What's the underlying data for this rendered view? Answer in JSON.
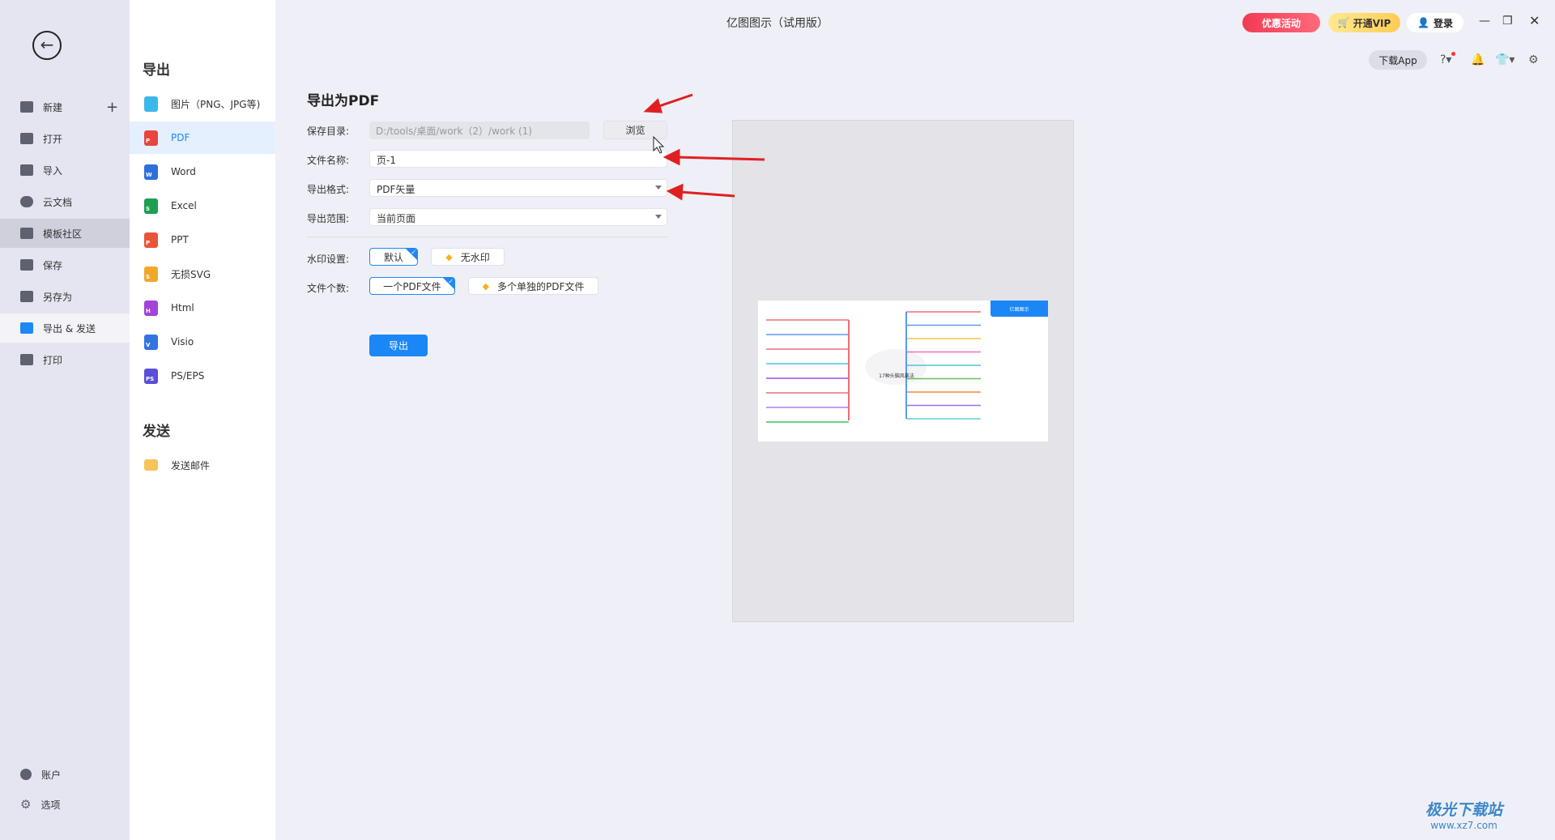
{
  "window": {
    "title": "亿图图示（试用版）"
  },
  "topbar": {
    "promo": "优惠活动",
    "vip": "开通VIP",
    "login": "登录",
    "download_app": "下载App"
  },
  "sidebar": {
    "items": [
      {
        "label": "新建",
        "icon": "plus-square-icon"
      },
      {
        "label": "打开",
        "icon": "folder-icon"
      },
      {
        "label": "导入",
        "icon": "import-icon"
      },
      {
        "label": "云文档",
        "icon": "cloud-icon"
      },
      {
        "label": "模板社区",
        "icon": "community-icon"
      },
      {
        "label": "保存",
        "icon": "save-icon"
      },
      {
        "label": "另存为",
        "icon": "save-as-icon"
      },
      {
        "label": "导出 & 发送",
        "icon": "export-icon"
      },
      {
        "label": "打印",
        "icon": "print-icon"
      }
    ],
    "bottom": [
      {
        "label": "账户",
        "icon": "account-icon"
      },
      {
        "label": "选项",
        "icon": "gear-icon"
      }
    ]
  },
  "export_panel": {
    "export_heading": "导出",
    "items": [
      {
        "label": "图片（PNG、JPG等)",
        "color": "#3cb8e8",
        "glyph": ""
      },
      {
        "label": "PDF",
        "color": "#e8453c",
        "glyph": "P"
      },
      {
        "label": "Word",
        "color": "#2f6fdc",
        "glyph": "W"
      },
      {
        "label": "Excel",
        "color": "#1d9f52",
        "glyph": "S"
      },
      {
        "label": "PPT",
        "color": "#e8553a",
        "glyph": "P"
      },
      {
        "label": "无损SVG",
        "color": "#f0a82a",
        "glyph": "S"
      },
      {
        "label": "Html",
        "color": "#a343d9",
        "glyph": "H"
      },
      {
        "label": "Visio",
        "color": "#3274e0",
        "glyph": "V"
      },
      {
        "label": "PS/EPS",
        "color": "#5a4fd6",
        "glyph": "PS"
      }
    ],
    "send_heading": "发送",
    "send_items": [
      {
        "label": "发送邮件"
      }
    ]
  },
  "form": {
    "title": "导出为PDF",
    "save_dir_label": "保存目录:",
    "save_dir_value": "D:/tools/桌面/work（2）/work (1)",
    "browse": "浏览",
    "filename_label": "文件名称:",
    "filename_value": "页-1",
    "format_label": "导出格式:",
    "format_value": "PDF矢量",
    "range_label": "导出范围:",
    "range_value": "当前页面",
    "watermark_label": "水印设置:",
    "watermark_options": [
      "默认",
      "无水印"
    ],
    "count_label": "文件个数:",
    "count_options": [
      "一个PDF文件",
      "多个单独的PDF文件"
    ],
    "export_button": "导出"
  },
  "preview": {
    "center_label": "17种头脑风暴法",
    "badge": "亿图图示"
  },
  "watermark_site": {
    "name": "极光下载站",
    "url": "www.xz7.com"
  },
  "colors": {
    "accent": "#1e88f5",
    "annotation_arrow": "#e02020"
  }
}
